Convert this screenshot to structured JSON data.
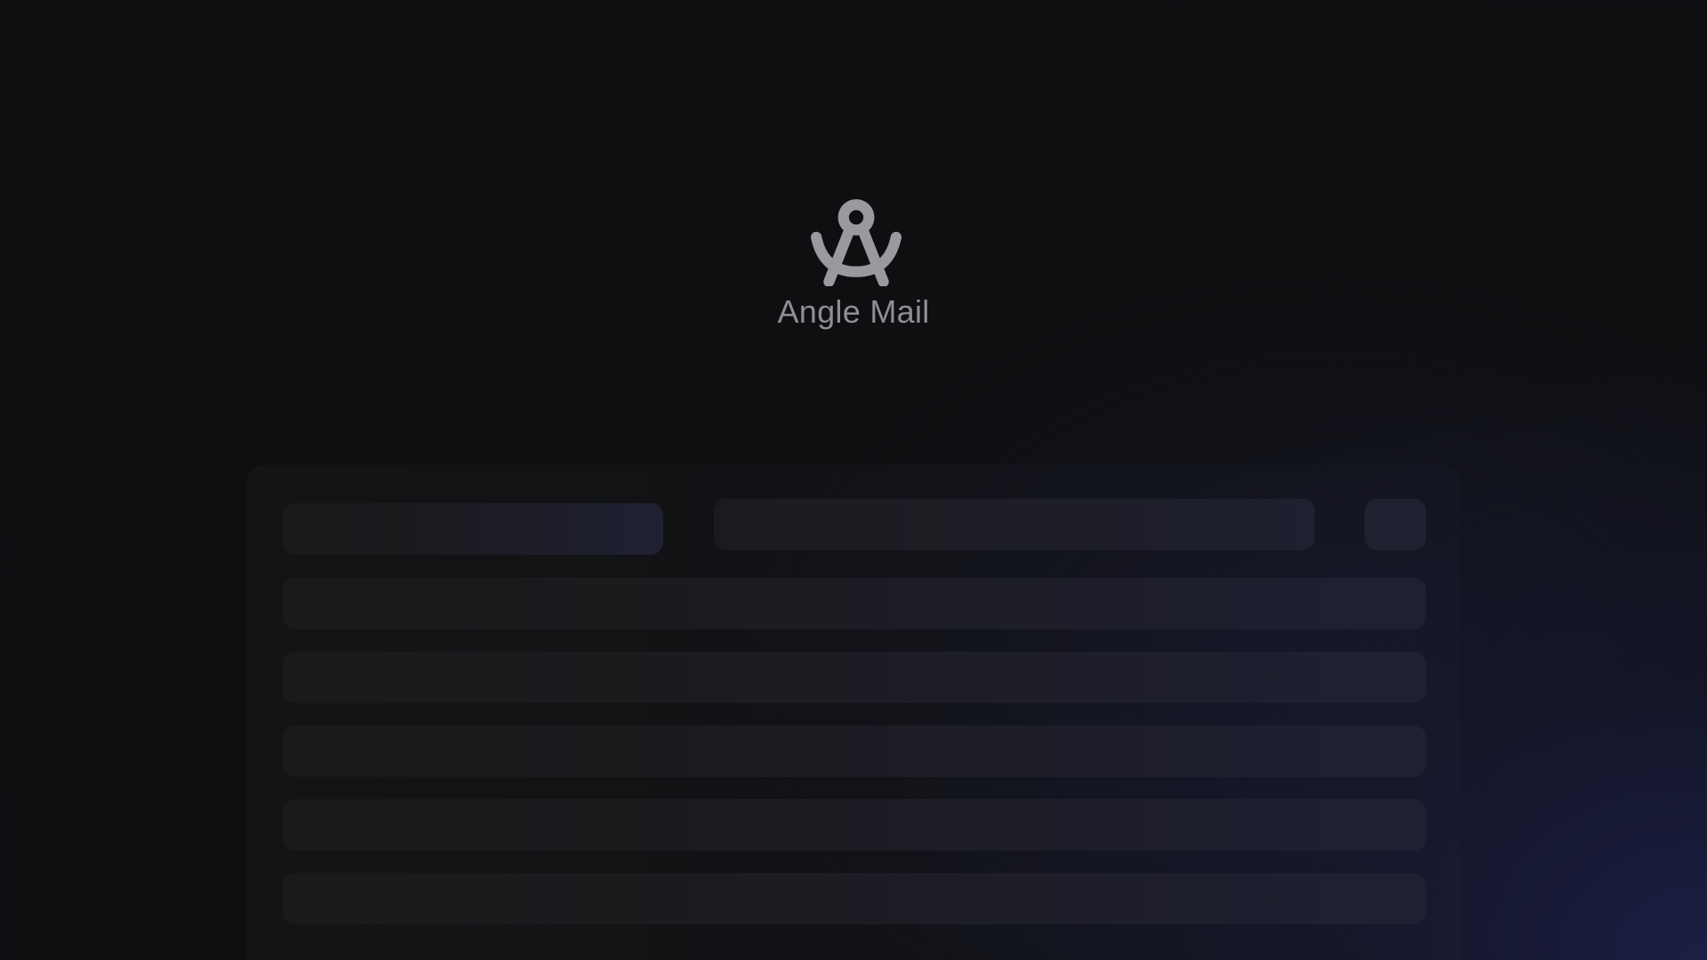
{
  "app": {
    "name": "Angle Mail",
    "logo_icon": "angle-mail-logo-icon",
    "logo_color": "#9a9a9e"
  },
  "loading": {
    "state": "skeleton",
    "toolbar_placeholders": 3,
    "row_placeholders": 5
  },
  "theme": {
    "background": "#0e0f10",
    "accent_glow": "#1e224e",
    "placeholder": "#1a1a1b"
  }
}
